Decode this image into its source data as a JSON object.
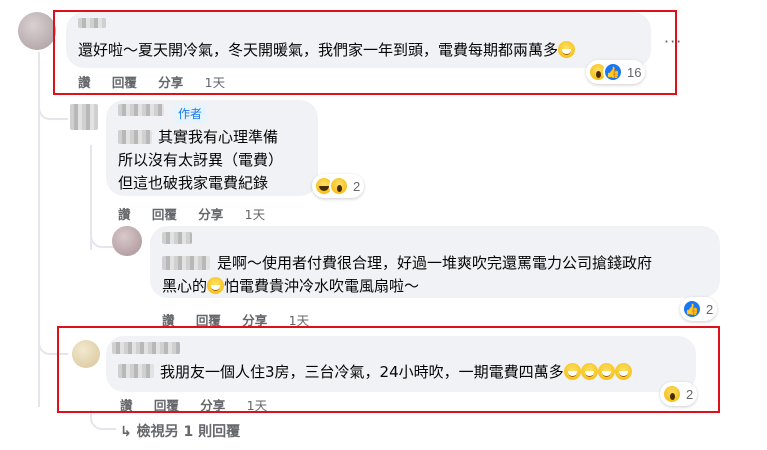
{
  "comment_1": {
    "text": "還好啦～夏天開冷氣，冬天開暖氣，我們家一年到頭，電費每期都兩萬多",
    "actions": {
      "like": "讚",
      "reply": "回覆",
      "share": "分享",
      "time": "1天"
    },
    "reaction_count": "16",
    "reaction_icons": [
      "wow-icon",
      "like-icon"
    ]
  },
  "reply_1": {
    "badge": "作者",
    "lines": [
      "其實我有心理準備",
      "所以沒有太訝異（電費）",
      "但這也破我家電費紀錄"
    ],
    "actions": {
      "like": "讚",
      "reply": "回覆",
      "share": "分享",
      "time": "1天"
    },
    "reaction_count": "2",
    "reaction_icons": [
      "haha-icon",
      "wow-icon"
    ]
  },
  "reply_2": {
    "line1": "是啊～使用者付費很合理，好過一堆爽吹完還罵電力公司搶錢政府",
    "line2a": "黑心的",
    "line2b": "怕電費貴沖冷水吹電風扇啦～",
    "actions": {
      "like": "讚",
      "reply": "回覆",
      "share": "分享",
      "time": "1天"
    },
    "reaction_count": "2",
    "reaction_icons": [
      "like-icon"
    ]
  },
  "reply_3": {
    "text": "我朋友一個人住3房，三台冷氣，24小時吹，一期電費四萬多",
    "actions": {
      "like": "讚",
      "reply": "回覆",
      "share": "分享",
      "time": "1天"
    },
    "reaction_count": "2",
    "reaction_icons": [
      "wow-icon"
    ]
  },
  "view_more": "↳ 檢視另 1 則回覆",
  "more_options": "···",
  "colors": {
    "highlight_box": "#e0101a",
    "bubble": "#f0f2f5",
    "meta": "#65676b",
    "author_badge": "#1877f2"
  }
}
